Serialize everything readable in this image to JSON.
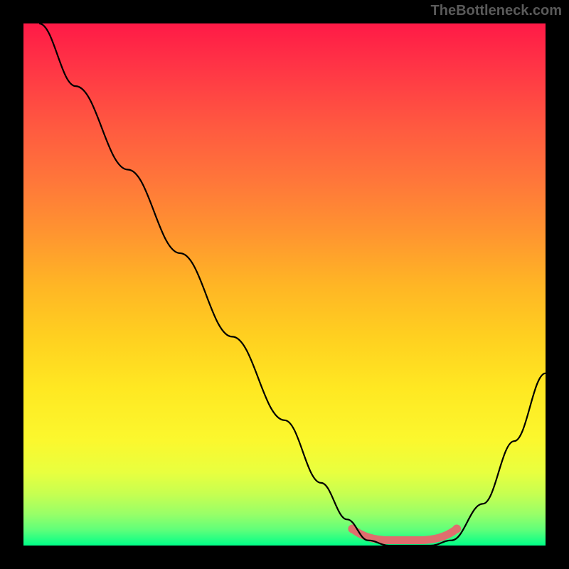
{
  "watermark": "TheBottleneck.com",
  "chart_data": {
    "type": "line",
    "title": "",
    "xlabel": "",
    "ylabel": "",
    "xlim": [
      0,
      100
    ],
    "ylim": [
      0,
      100
    ],
    "grid": false,
    "series": [
      {
        "name": "bottleneck-curve",
        "color": "#000000",
        "x": [
          3,
          10,
          20,
          30,
          40,
          50,
          57,
          62,
          66,
          70,
          74,
          78,
          82,
          88,
          94,
          100
        ],
        "y": [
          100,
          88,
          72,
          56,
          40,
          24,
          12,
          5,
          1,
          0,
          0,
          0,
          1,
          8,
          20,
          33
        ]
      }
    ],
    "annotations": [
      {
        "name": "optimal-range",
        "type": "highlight",
        "color": "#e57373",
        "x_start": 63,
        "x_end": 83,
        "y": 0,
        "thickness": 11
      }
    ],
    "gradient_stops": [
      {
        "pos": 0,
        "color": "#ff1a47"
      },
      {
        "pos": 50,
        "color": "#ffb525"
      },
      {
        "pos": 80,
        "color": "#fbf82e"
      },
      {
        "pos": 100,
        "color": "#00ff88"
      }
    ]
  }
}
